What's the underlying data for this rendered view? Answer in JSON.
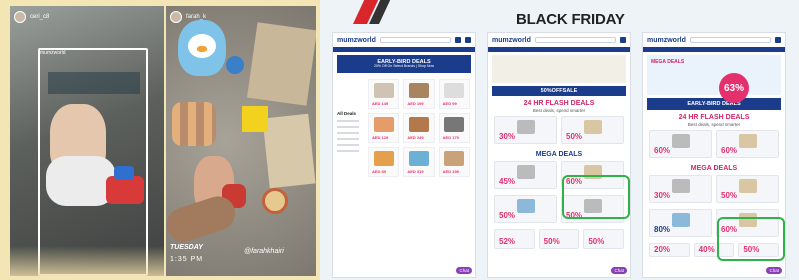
{
  "panel1": {
    "username": "ceri_c8",
    "brand_tag": "mumzworld"
  },
  "panel2": {
    "username": "farah_k",
    "day": "TUESDAY",
    "time": "1:35 PM",
    "handle": "@farahkhairi"
  },
  "panel3": {
    "title": "BLACK FRIDAY",
    "mock_logo": "mumzworld",
    "mock1": {
      "banner": "EARLY-BIRD DEALS",
      "banner_sub": "20% Off On Select Brands | Shop Now",
      "sidebar_title": "All Deals",
      "prices": [
        "AED 149",
        "AED 199",
        "AED 99",
        "AED 129",
        "AED 249",
        "AED 179",
        "AED 89",
        "AED 319",
        "AED 159"
      ],
      "chat": "Chat"
    },
    "mock2": {
      "banner": "50%OFFSALE",
      "section1": "24 HR FLASH DEALS",
      "section1_sub": "Best deals, spend smarter",
      "flash_pct": [
        "30%",
        "50%"
      ],
      "section2": "MEGA DEALS",
      "mega_pct": [
        "45%",
        "60%",
        "50%",
        "50%",
        "52%",
        "50%",
        "50%"
      ],
      "chat": "Chat"
    },
    "mock3": {
      "banner_title": "MEGA DEALS",
      "badge": "63%",
      "banner": "EARLY-BIRD DEALS",
      "section1": "24 HR FLASH DEALS",
      "section1_sub": "Best deals, spend smarter",
      "flash_pct": [
        "60%",
        "60%"
      ],
      "section2": "MEGA DEALS",
      "mega_pct": [
        "30%",
        "50%",
        "80%",
        "60%",
        "20%",
        "40%",
        "50%"
      ],
      "chat": "Chat"
    }
  },
  "colors": {
    "brand_navy": "#1b3c8a",
    "deal_pink": "#e4316d",
    "highlight_green": "#2fb24a",
    "bg_cream": "#f3e5b4"
  }
}
